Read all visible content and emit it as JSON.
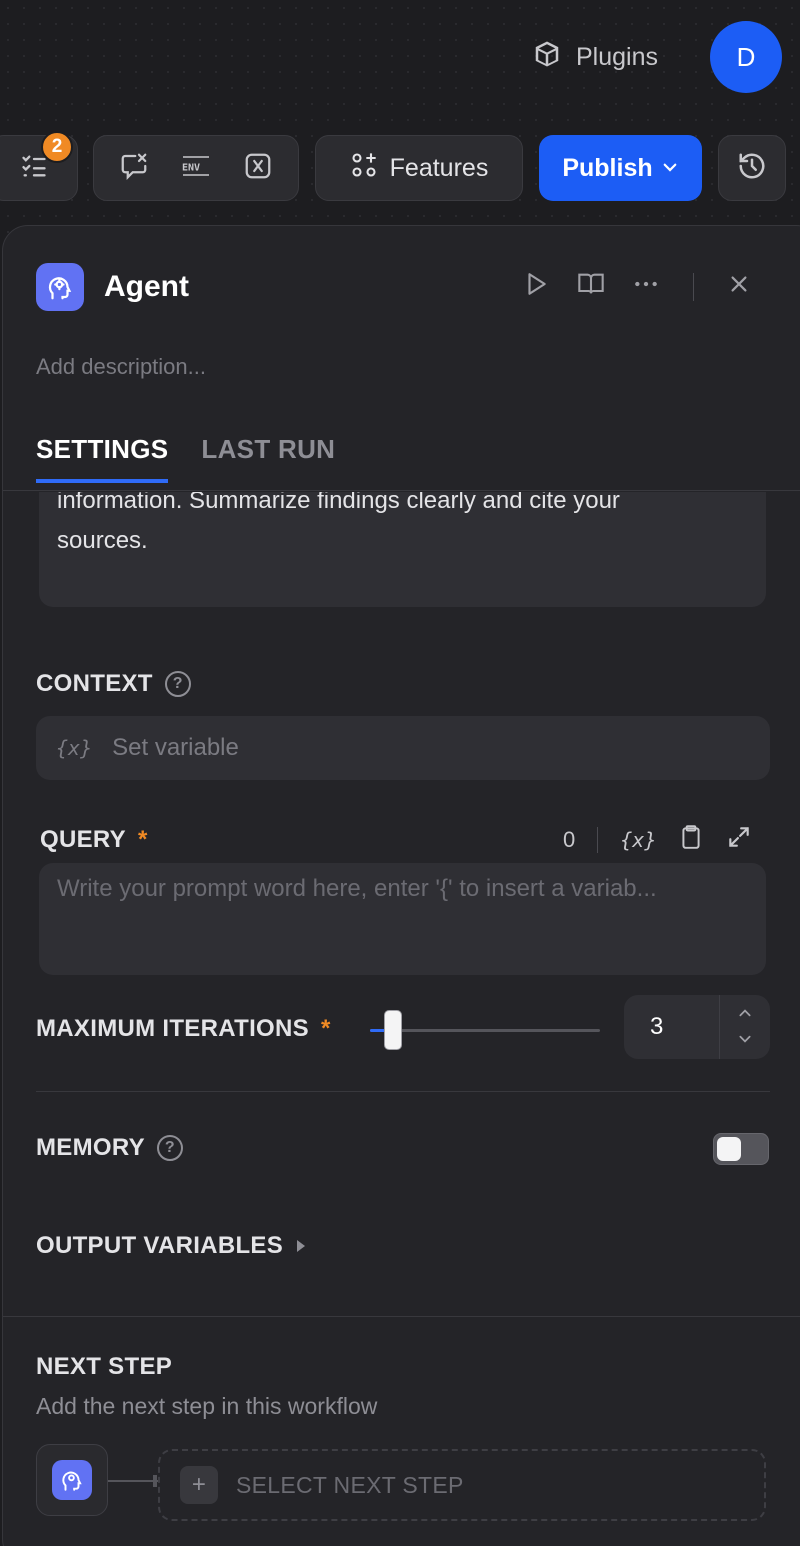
{
  "topbar": {
    "plugins_label": "Plugins",
    "avatar_initial": "D"
  },
  "toolbar": {
    "checklist_badge": "2",
    "features_label": "Features",
    "publish_label": "Publish",
    "var_icons": [
      "chat-variable-icon",
      "env-icon",
      "variable-icon"
    ]
  },
  "node": {
    "title": "Agent",
    "description_placeholder": "Add description...",
    "tabs": [
      "SETTINGS",
      "LAST RUN"
    ],
    "active_tab": "SETTINGS"
  },
  "instruction": {
    "line1": "information. Summarize findings clearly and cite your",
    "line2": "sources."
  },
  "context": {
    "label": "CONTEXT",
    "placeholder": "Set variable",
    "var_icon_text": "{x}"
  },
  "query": {
    "label": "QUERY",
    "required_mark": "*",
    "char_count": "0",
    "var_icon_text": "{x}",
    "placeholder": "Write your prompt word here, enter '{' to insert a variab..."
  },
  "max_iterations": {
    "label": "MAXIMUM ITERATIONS",
    "required_mark": "*",
    "value": "3",
    "slider_fraction": 0.1
  },
  "memory": {
    "label": "MEMORY",
    "enabled": false
  },
  "output_variables": {
    "label": "OUTPUT VARIABLES"
  },
  "next_step": {
    "title": "NEXT STEP",
    "description": "Add the next step in this workflow",
    "select_label": "SELECT NEXT STEP"
  },
  "colors": {
    "accent": "#1c5df5",
    "node_icon_bg": "#6172f3",
    "badge": "#f08a24"
  }
}
